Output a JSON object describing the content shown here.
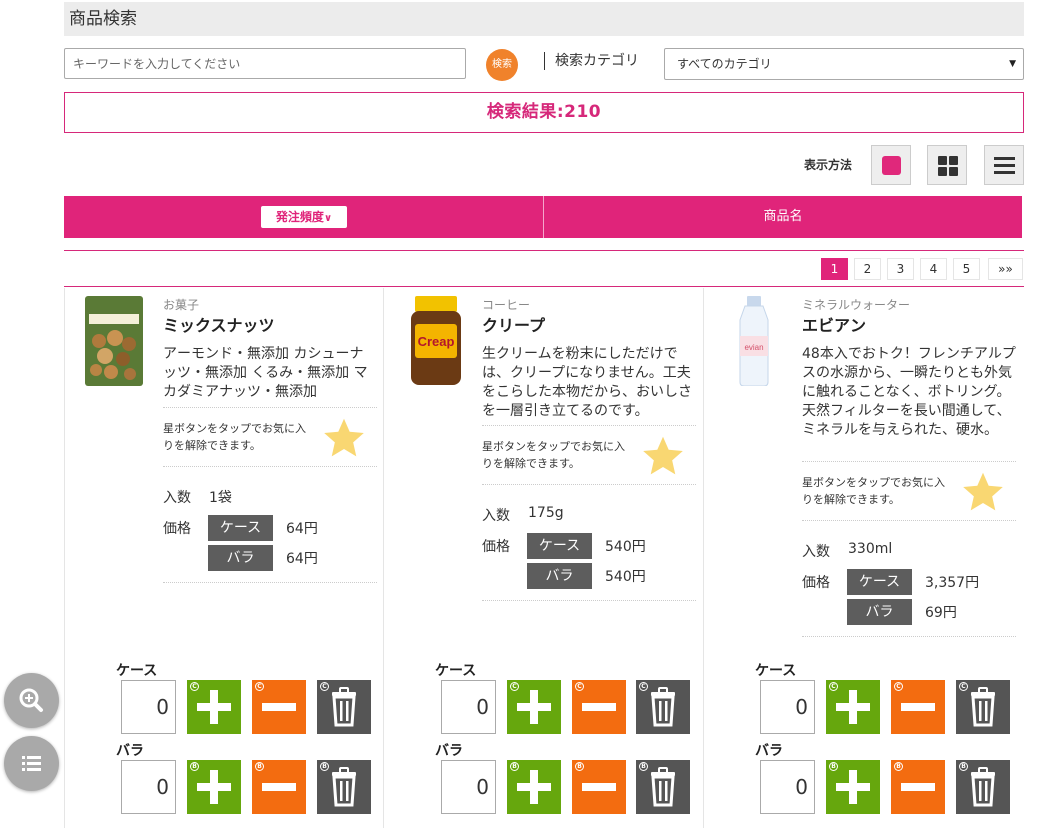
{
  "header": {
    "title": "商品検索"
  },
  "search": {
    "placeholder": "キーワードを入力してください",
    "button_label": "検索",
    "category_label": "検索カテゴリ",
    "category_selected": "すべてのカテゴリ"
  },
  "result": {
    "text": "検索結果:210"
  },
  "view": {
    "label": "表示方法",
    "active": "single"
  },
  "sort": {
    "active_label": "発注頻度",
    "other_label": "商品名"
  },
  "pagination": {
    "pages": [
      "1",
      "2",
      "3",
      "4",
      "5"
    ],
    "current": "1",
    "next_label": "»»"
  },
  "fav_hint": "星ボタンをタップでお気に入りを解除できます。",
  "labels": {
    "qty": "入数",
    "price": "価格",
    "case": "ケース",
    "bara": "バラ"
  },
  "products": [
    {
      "category": "お菓子",
      "name": "ミックスナッツ",
      "description": "アーモンド・無添加 カシューナッツ・無添加 くるみ・無添加 マカダミアナッツ・無添加",
      "quantity": "1袋",
      "price_case": "64円",
      "price_bara": "64円",
      "case_count": "0",
      "bara_count": "0"
    },
    {
      "category": "コーヒー",
      "name": "クリープ",
      "description": "生クリームを粉末にしただけでは、クリープになりません。工夫をこらした本物だから、おいしさを一層引き立てるのです。",
      "quantity": "175g",
      "price_case": "540円",
      "price_bara": "540円",
      "case_count": "0",
      "bara_count": "0",
      "image_text": "Creap"
    },
    {
      "category": "ミネラルウォーター",
      "name": "エビアン",
      "description": "48本入でおトク！フレンチアルプスの水源から、一瞬たりとも外気に触れることなく、ボトリング。天然フィルターを長い間通して、ミネラルを与えられた、硬水。",
      "quantity": "330ml",
      "price_case": "3,357円",
      "price_bara": "69円",
      "case_count": "0",
      "bara_count": "0",
      "image_text": "evian"
    }
  ],
  "badges": {
    "case": "C",
    "bara": "B"
  },
  "colors": {
    "accent": "#e0247a",
    "plus": "#66a70d",
    "minus": "#f36c10",
    "trash": "#555555",
    "search": "#f0822b",
    "star": "#f9d772"
  }
}
